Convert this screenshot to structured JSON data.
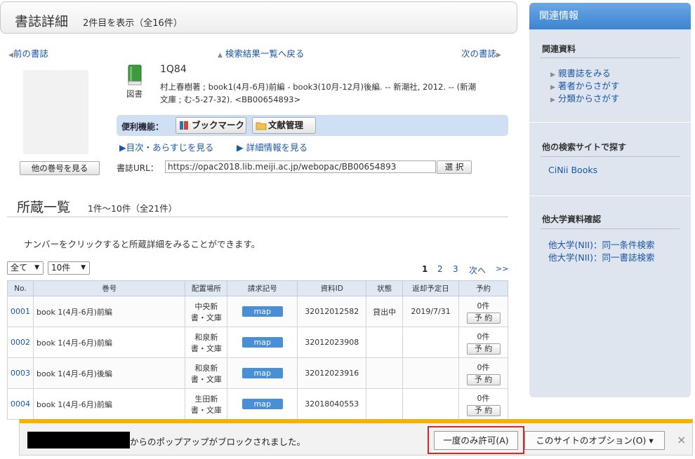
{
  "header": {
    "title": "書誌詳細",
    "subtitle": "2件目を表示（全16件）"
  },
  "nav": {
    "prev": "前の書誌",
    "back": "検索結果一覧へ戻る",
    "next": "次の書誌"
  },
  "book": {
    "type_label": "図書",
    "title": "1Q84",
    "desc_line1": "村上春樹著 ; book1(4月-6月)前編 - book3(10月-12月)後編. -- 新潮社, 2012. -- (新潮",
    "desc_line2": "文庫 ; む-5-27-32). <BB00654893>",
    "other_volumes": "他の巻号を見る"
  },
  "tools": {
    "label": "便利機能：",
    "bookmark": "ブックマーク",
    "refman": "文献管理"
  },
  "sublinks": {
    "toc": "目次・あらすじを見る",
    "detail": "詳細情報を見る"
  },
  "url": {
    "label": "書誌URL：",
    "value": "https://opac2018.lib.meiji.ac.jp/webopac/BB00654893",
    "select": "選 択"
  },
  "holdings": {
    "title": "所蔵一覧",
    "count": "1件～10件（全21件）",
    "hint": "ナンバーをクリックすると所蔵詳細をみることができます。",
    "filter": "全て",
    "per_page": "10件",
    "pager": {
      "p1": "1",
      "p2": "2",
      "p3": "3",
      "next": "次へ",
      "last": ">>"
    },
    "columns": [
      "No.",
      "巻号",
      "配置場所",
      "請求記号",
      "資料ID",
      "状態",
      "返却予定日",
      "予約"
    ],
    "rows": [
      {
        "no": "0001",
        "vol": "book 1(4月-6月)前編",
        "loc1": "中央新",
        "loc2": "書・文庫",
        "call": "map",
        "id": "32012012582",
        "status": "貸出中",
        "due": "2019/7/31",
        "res_count": "0件",
        "res_btn": "予 約"
      },
      {
        "no": "0002",
        "vol": "book 1(4月-6月)前編",
        "loc1": "和泉新",
        "loc2": "書・文庫",
        "call": "map",
        "id": "32012023908",
        "status": "",
        "due": "",
        "res_count": "0件",
        "res_btn": "予 約"
      },
      {
        "no": "0003",
        "vol": "book 1(4月-6月)後編",
        "loc1": "和泉新",
        "loc2": "書・文庫",
        "call": "map",
        "id": "32012023916",
        "status": "",
        "due": "",
        "res_count": "0件",
        "res_btn": "予 約"
      },
      {
        "no": "0004",
        "vol": "book 1(4月-6月)前編",
        "loc1": "生田新",
        "loc2": "書・文庫",
        "call": "map",
        "id": "32018040553",
        "status": "",
        "due": "",
        "res_count": "0件",
        "res_btn": "予 約"
      }
    ]
  },
  "sidebar": {
    "title": "関連情報",
    "related": {
      "heading": "関連資料",
      "items": [
        "親書誌をみる",
        "著者からさがす",
        "分類からさがす"
      ]
    },
    "other_sites": {
      "heading": "他の検索サイトで探す",
      "items": [
        "CiNii Books"
      ]
    },
    "other_univ": {
      "heading": "他大学資料確認",
      "items": [
        "他大学(NII)：同一条件検索",
        "他大学(NII)：同一書誌検索"
      ]
    }
  },
  "notification": {
    "message": "からのポップアップがブロックされました。",
    "allow_once": "一度のみ許可(A)",
    "options": "このサイトのオプション(O) ▾",
    "close": "×"
  },
  "colors": {
    "accent_blue": "#3d84d0",
    "link": "#1a56a6",
    "warning_bar": "#f2b20a",
    "highlight_frame": "#d9262a"
  }
}
